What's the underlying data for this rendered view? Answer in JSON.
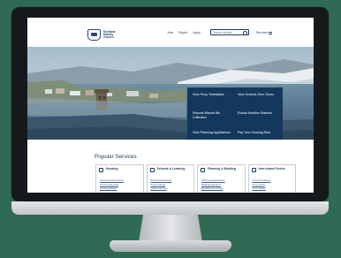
{
  "header": {
    "logo_lines": [
      "Shetland",
      "Islands",
      "Council"
    ],
    "nav": [
      "Jobs",
      "Report",
      "Apply"
    ],
    "search_placeholder": "Search website...",
    "services_label": "Services"
  },
  "quick_links": [
    "View Ferry Timetables",
    "View Schools Term Times",
    "Reports Missed Bin Collection",
    "Roads Weather Stations",
    "View Planning Applications",
    "Pay Your Housing Rent"
  ],
  "popular": {
    "title": "Popular Services",
    "cards": [
      {
        "title": "Housing",
        "links": [
          "Council Housing Rent",
          "Housing Benefits",
          "Housing Advice"
        ]
      },
      {
        "title": "Schools & Learning",
        "links": [
          "School Admissions",
          "School Meals",
          "Adult Learning"
        ]
      },
      {
        "title": "Planning & Building",
        "links": [
          "Planning Applications",
          "Building Warrants",
          "Development Plans"
        ]
      },
      {
        "title": "Inter-Island Ferries",
        "links": [
          "Ferry Timetables",
          "Ferry Fares",
          "Ferry Status"
        ]
      }
    ]
  },
  "colors": {
    "background": "#2f6a55",
    "panel": "#14385d",
    "brand_text": "#1d3b5c"
  }
}
